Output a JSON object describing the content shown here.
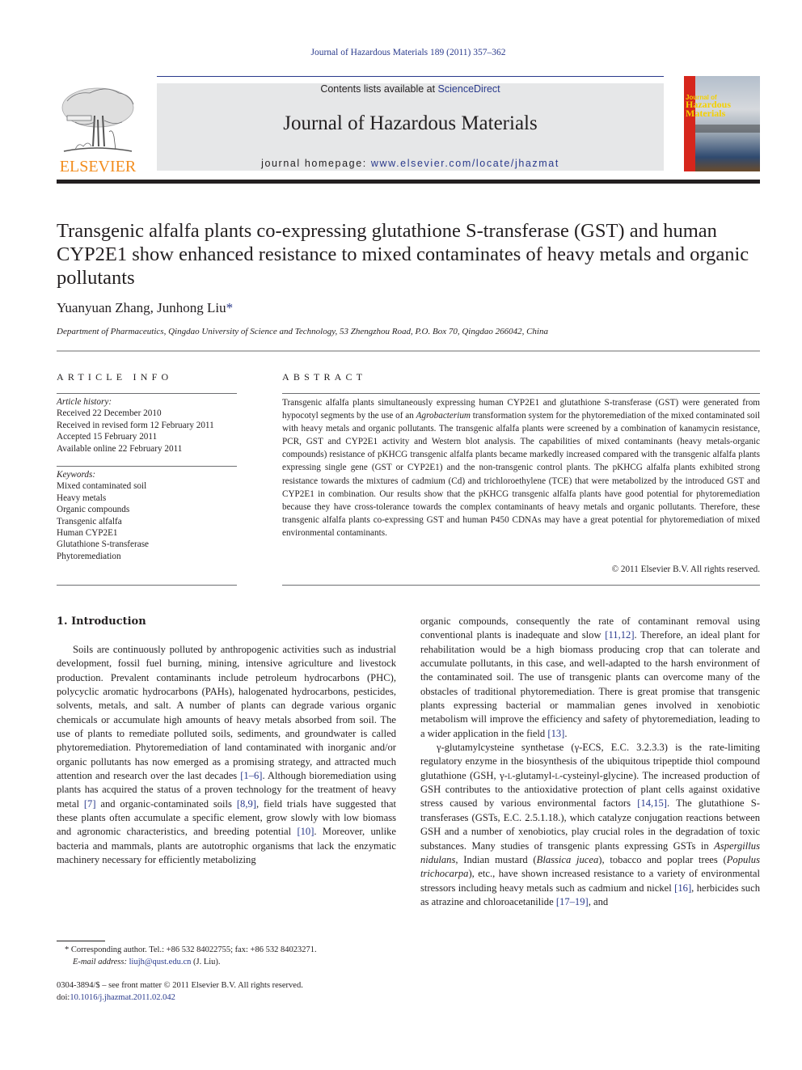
{
  "header": {
    "running_head": "Journal of Hazardous Materials 189 (2011) 357–362",
    "publisher": "ELSEVIER",
    "contents_prefix": "Contents lists available at ",
    "contents_link": "ScienceDirect",
    "journal_title": "Journal of Hazardous Materials",
    "homepage_prefix": "journal homepage: ",
    "homepage_link": "www.elsevier.com/locate/jhazmat",
    "cover": {
      "line1": "Journal of",
      "line2": "Hazardous",
      "line3": "Materials"
    },
    "colors": {
      "elsevier_orange": "#f28c1d",
      "link_blue": "#2a3a8c",
      "banner_gray": "#e6e7e8",
      "cover_red": "#d6261c"
    }
  },
  "article": {
    "title": "Transgenic alfalfa plants co-expressing glutathione S-transferase (GST) and human CYP2E1 show enhanced resistance to mixed contaminates of heavy metals and organic pollutants",
    "authors": "Yuanyuan Zhang, Junhong Liu",
    "corresponding_mark": "*",
    "affiliation": "Department of Pharmaceutics, Qingdao University of Science and Technology, 53 Zhengzhou Road, P.O. Box 70, Qingdao 266042, China"
  },
  "article_info": {
    "heading": "ARTICLE INFO",
    "history_label": "Article history:",
    "history": [
      "Received 22 December 2010",
      "Received in revised form 12 February 2011",
      "Accepted 15 February 2011",
      "Available online 22 February 2011"
    ],
    "keywords_label": "Keywords:",
    "keywords": [
      "Mixed contaminated soil",
      "Heavy metals",
      "Organic compounds",
      "Transgenic alfalfa",
      "Human CYP2E1",
      "Glutathione S-transferase",
      "Phytoremediation"
    ]
  },
  "abstract": {
    "heading": "ABSTRACT",
    "text_1": "Transgenic alfalfa plants simultaneously expressing human CYP2E1 and glutathione S-transferase (GST) were generated from hypocotyl segments by the use of an ",
    "italic_1": "Agrobacterium",
    "text_2": " transformation system for the phytoremediation of the mixed contaminated soil with heavy metals and organic pollutants. The transgenic alfalfa plants were screened by a combination of kanamycin resistance, PCR, GST and CYP2E1 activity and Western blot analysis. The capabilities of mixed contaminants (heavy metals-organic compounds) resistance of pKHCG transgenic alfalfa plants became markedly increased compared with the transgenic alfalfa plants expressing single gene (GST or CYP2E1) and the non-transgenic control plants. The pKHCG alfalfa plants exhibited strong resistance towards the mixtures of cadmium (Cd) and trichloroethylene (TCE) that were metabolized by the introduced GST and CYP2E1 in combination. Our results show that the pKHCG transgenic alfalfa plants have good potential for phytoremediation because they have cross-tolerance towards the complex contaminants of heavy metals and organic pollutants. Therefore, these transgenic alfalfa plants co-expressing GST and human P450 CDNAs may have a great potential for phytoremediation of mixed environmental contaminants.",
    "copyright": "© 2011 Elsevier B.V. All rights reserved."
  },
  "introduction": {
    "heading": "1.  Introduction",
    "p1": [
      {
        "t": "Soils are continuously polluted by anthropogenic activities such as industrial development, fossil fuel burning, mining, intensive agriculture and livestock production. Prevalent contaminants include petroleum hydrocarbons (PHC), polycyclic aromatic hydrocarbons (PAHs), halogenated hydrocarbons, pesticides, solvents, metals, and salt. A number of plants can degrade various organic chemicals or accumulate high amounts of heavy metals absorbed from soil. The use of plants to remediate polluted soils, sediments, and groundwater is called phytoremediation. Phytoremediation of land contaminated with inorganic and/or organic pollutants has now emerged as a promising strategy, and attracted much attention and research over the last decades "
      },
      {
        "ref": "[1–6]"
      },
      {
        "t": ". Although bioremediation using plants has acquired the status of a proven technology for the treatment of heavy metal "
      },
      {
        "ref": "[7]"
      },
      {
        "t": " and organic-contaminated soils "
      },
      {
        "ref": "[8,9]"
      },
      {
        "t": ", field trials have suggested that these plants often accumulate a specific element, grow slowly with low biomass and agronomic characteristics, and breeding potential "
      },
      {
        "ref": "[10]"
      },
      {
        "t": ". Moreover, unlike bacteria and mammals, plants are autotrophic organisms that lack the enzymatic machinery necessary for efficiently metabolizing organic compounds, consequently the rate of contaminant removal using conventional plants is inadequate and slow "
      },
      {
        "ref": "[11,12]"
      },
      {
        "t": ". Therefore, an ideal plant for rehabilitation would be a high biomass producing crop that can tolerate and accumulate pollutants, in this case, and well-adapted to the harsh environment of the contaminated soil. The use of transgenic plants can overcome many of the obstacles of traditional phytoremediation. There is great promise that transgenic plants expressing bacterial or mammalian genes involved in xenobiotic metabolism will improve the efficiency and safety of phytoremediation, leading to a wider application in the field "
      },
      {
        "ref": "[13]"
      },
      {
        "t": "."
      }
    ],
    "p1_left": "Soils are continuously polluted by anthropogenic activities such as industrial development, fossil fuel burning, mining, intensive agriculture and livestock production. Prevalent contaminants include petroleum hydrocarbons (PHC), polycyclic aromatic hydrocarbons (PAHs), halogenated hydrocarbons, pesticides, solvents, metals, and salt. A number of plants can degrade various organic chemicals or accumulate high amounts of heavy metals absorbed from soil. The use of plants to remediate polluted soils, sediments, and groundwater is called phytoremediation. Phytoremediation of land contaminated with inorganic and/or organic pollutants has now emerged as a promising strategy, and attracted much attention and research over the last decades ",
    "ref_1_6": "[1–6]",
    "p1_left_b": ". Although bioremediation using plants has acquired the status of a proven technology for the treatment of heavy metal ",
    "ref_7": "[7]",
    "p1_left_c": " and organic-contaminated soils ",
    "ref_8_9": "[8,9]",
    "p1_left_d": ", field trials have suggested that these plants often accumulate a specific element, grow slowly with low biomass and agronomic characteristics, and breeding potential ",
    "ref_10": "[10]",
    "p1_left_e": ". Moreover, unlike bacteria and mammals, plants are autotrophic organisms that lack the enzymatic machinery necessary for efficiently metabolizing",
    "p1_right_a": "organic compounds, consequently the rate of contaminant removal using conventional plants is inadequate and slow ",
    "ref_11_12": "[11,12]",
    "p1_right_b": ". Therefore, an ideal plant for rehabilitation would be a high biomass producing crop that can tolerate and accumulate pollutants, in this case, and well-adapted to the harsh environment of the contaminated soil. The use of transgenic plants can overcome many of the obstacles of traditional phytoremediation. There is great promise that transgenic plants expressing bacterial or mammalian genes involved in xenobiotic metabolism will improve the efficiency and safety of phytoremediation, leading to a wider application in the field ",
    "ref_13": "[13]",
    "p1_right_c": ".",
    "p2_a": "γ-glutamylcysteine synthetase (γ-ECS, E.C. 3.2.3.3) is the rate-limiting regulatory enzyme in the biosynthesis of the ubiquitous tripeptide thiol compound glutathione (GSH, γ-",
    "p2_sc1": "l",
    "p2_b": "-glutamyl-",
    "p2_sc2": "l",
    "p2_c": "-cysteinyl-glycine). The increased production of GSH contributes to the antioxidative protection of plant cells against oxidative stress caused by various environmental factors ",
    "ref_14_15": "[14,15]",
    "p2_d": ". The glutathione S-transferases (GSTs, E.C. 2.5.1.18.), which catalyze conjugation reactions between GSH and a number of xenobiotics, play crucial roles in the degradation of toxic substances. Many studies of transgenic plants expressing GSTs in ",
    "p2_it1": "Aspergillus nidulans",
    "p2_e": ", Indian mustard (",
    "p2_it2": "Blassica jucea",
    "p2_f": "), tobacco and poplar trees (",
    "p2_it3": "Populus trichocarpa",
    "p2_g": "), etc., have shown increased resistance to a variety of environmental stressors including heavy metals such as cadmium and nickel ",
    "ref_16": "[16]",
    "p2_h": ", herbicides such as atrazine and chloroacetanilide ",
    "ref_17_19": "[17–19]",
    "p2_i": ", and"
  },
  "footnote": {
    "mark": "*",
    "text": " Corresponding author. Tel.: +86 532 84022755; fax: +86 532 84023271.",
    "email_label": "E-mail address:",
    "email": "liujh@qust.edu.cn",
    "email_suffix": " (J. Liu)."
  },
  "front_matter": {
    "issn_line": "0304-3894/$ – see front matter © 2011 Elsevier B.V. All rights reserved.",
    "doi_prefix": "doi:",
    "doi": "10.1016/j.jhazmat.2011.02.042"
  }
}
